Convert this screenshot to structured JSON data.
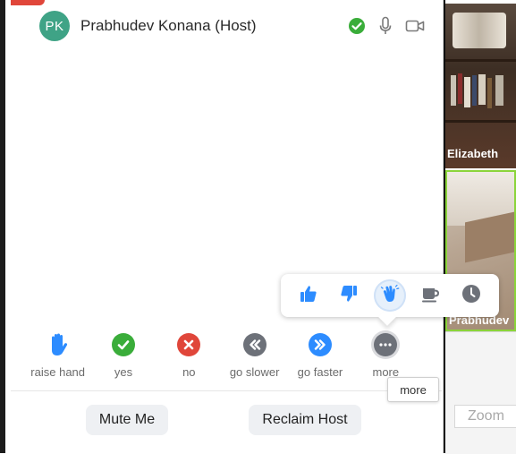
{
  "host": {
    "initials": "PK",
    "name": "Prabhudev Konana (Host)",
    "avatar_color": "#3fa386"
  },
  "reactions": [
    {
      "icon": "thumbs-up-icon",
      "active": false
    },
    {
      "icon": "thumbs-down-icon",
      "active": false
    },
    {
      "icon": "clap-icon",
      "active": true
    },
    {
      "icon": "coffee-icon",
      "active": false
    },
    {
      "icon": "clock-icon",
      "active": false
    }
  ],
  "feedback": [
    {
      "key": "raise_hand",
      "label": "raise hand",
      "icon": "raise-hand-icon",
      "color": "#2d8cff"
    },
    {
      "key": "yes",
      "label": "yes",
      "icon": "check-icon",
      "color": "#3aad3a"
    },
    {
      "key": "no",
      "label": "no",
      "icon": "x-icon",
      "color": "#e0463a"
    },
    {
      "key": "go_slower",
      "label": "go slower",
      "icon": "rewind-icon",
      "color": "#6d7179"
    },
    {
      "key": "go_faster",
      "label": "go faster",
      "icon": "fast-forward-icon",
      "color": "#2d8cff"
    },
    {
      "key": "more",
      "label": "more",
      "icon": "ellipsis-icon",
      "color": "#6d7179"
    }
  ],
  "tooltip": "more",
  "buttons": {
    "mute_me": "Mute Me",
    "reclaim_host": "Reclaim Host"
  },
  "videos": [
    {
      "label": "Elizabeth"
    },
    {
      "label": "Prabhudev"
    }
  ],
  "zoom_input": {
    "placeholder": "Zoom"
  },
  "colors": {
    "accent_blue": "#2d8cff",
    "green": "#3aad3a",
    "red": "#e0463a",
    "grey_icon": "#6d7179",
    "active_border": "#8bd43a"
  }
}
